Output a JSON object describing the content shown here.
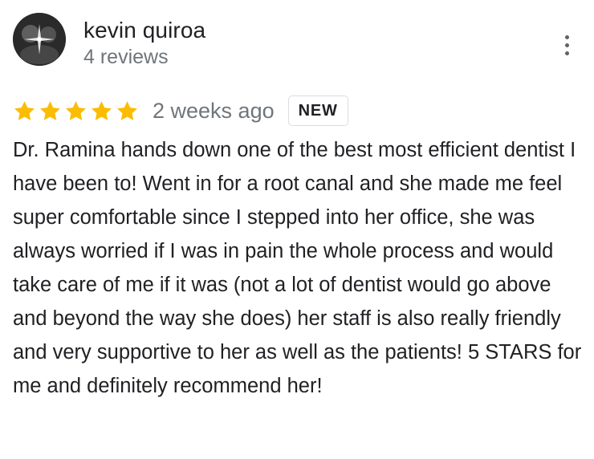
{
  "reviewer": {
    "name": "kevin quiroa",
    "review_count": "4 reviews",
    "avatar_icon": "profile-photo"
  },
  "menu": {
    "icon": "more-vert-icon"
  },
  "rating": {
    "stars": 5,
    "max_stars": 5,
    "star_color": "#fbbc04"
  },
  "review": {
    "date": "2 weeks ago",
    "badge": "NEW",
    "text": "Dr. Ramina hands down one of the best most efficient dentist I have been to! Went in for a root canal and she made me feel super comfortable since I stepped into her office, she was always worried if I was in pain the whole process and would take care of me if it was (not a lot of dentist would go above and beyond the way she does) her staff is also really friendly and very supportive to her as well as the patients! 5 STARS for me and definitely recommend her!"
  },
  "colors": {
    "primary_text": "#202124",
    "secondary_text": "#70757a",
    "badge_border": "#dadce0"
  }
}
